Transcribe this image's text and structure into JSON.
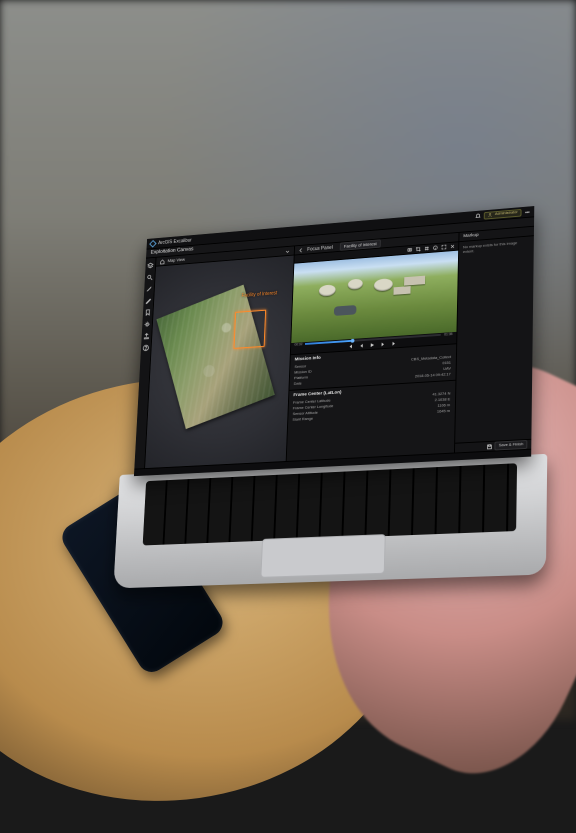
{
  "app": {
    "title": "ArcGIS Excalibur"
  },
  "user": {
    "name": "Administrator"
  },
  "breadcrumb": "Exploitation Canvas",
  "map_panel": {
    "title": "Map View",
    "foi_label": "Facility of Interest"
  },
  "focus_panel": {
    "title": "Focus Panel",
    "tab": "Facility of Interest"
  },
  "video": {
    "progress_pct": 34,
    "time_current": "00:32",
    "time_total": "01:35"
  },
  "meta": {
    "section1": {
      "heading": "Mission Info",
      "rows": [
        {
          "k": "Sensor",
          "v": "CBS_Metadata_Collect"
        },
        {
          "k": "Mission ID",
          "v": "0151"
        },
        {
          "k": "Platform",
          "v": "UAV"
        },
        {
          "k": "Date",
          "v": "2018-05-14 09:42:17"
        }
      ]
    },
    "section2": {
      "heading": "Frame Center (LatLon)",
      "rows": [
        {
          "k": "Frame Center Latitude",
          "v": "41.3274 N"
        },
        {
          "k": "Frame Center Longitude",
          "v": "2.1038 E"
        },
        {
          "k": "Sensor Altitude",
          "v": "1106 m"
        },
        {
          "k": "Slant Range",
          "v": "1645 m"
        }
      ]
    }
  },
  "right": {
    "title": "Markup",
    "message": "No markup exists for this image extent.",
    "button": "Save & Finish"
  },
  "toolrail": {
    "items": [
      "layers",
      "search",
      "measure",
      "draw",
      "bookmark",
      "settings",
      "export",
      "help"
    ]
  },
  "statusbar": {
    "left": "",
    "right": ""
  }
}
